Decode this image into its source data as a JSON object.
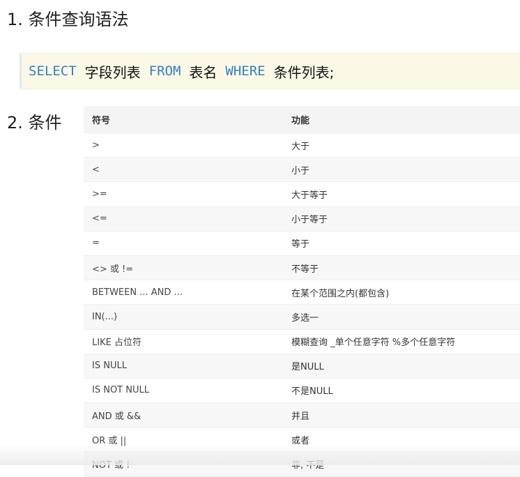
{
  "headings": {
    "syntax": "1. 条件查询语法",
    "conditions": "2. 条件"
  },
  "code": {
    "select": "SELECT",
    "fields": "字段列表",
    "from": "FROM",
    "table": "表名",
    "where": "WHERE",
    "condition_list": "条件列表;"
  },
  "table": {
    "headers": [
      "符号",
      "功能"
    ],
    "rows": [
      {
        "symbol": ">",
        "function": "大于"
      },
      {
        "symbol": "<",
        "function": "小于"
      },
      {
        "symbol": ">=",
        "function": "大于等于"
      },
      {
        "symbol": "<=",
        "function": "小于等于"
      },
      {
        "symbol": "=",
        "function": "等于"
      },
      {
        "symbol": "<> 或 !=",
        "function": "不等于"
      },
      {
        "symbol": "BETWEEN ... AND ...",
        "function": "在某个范围之内(都包含)"
      },
      {
        "symbol": "IN(...)",
        "function": "多选一"
      },
      {
        "symbol": "LIKE 占位符",
        "function": "模糊查询 _单个任意字符 %多个任意字符"
      },
      {
        "symbol": "IS NULL",
        "function": "是NULL"
      },
      {
        "symbol": "IS NOT NULL",
        "function": "不是NULL"
      },
      {
        "symbol": "AND 或 &&",
        "function": "并且"
      },
      {
        "symbol": "OR 或 ||",
        "function": "或者"
      },
      {
        "symbol": "NOT 或 !",
        "function": "非, 不是"
      }
    ]
  },
  "colors": {
    "keyword": "#2f7fc8",
    "code_background": "#fbf9e6"
  }
}
